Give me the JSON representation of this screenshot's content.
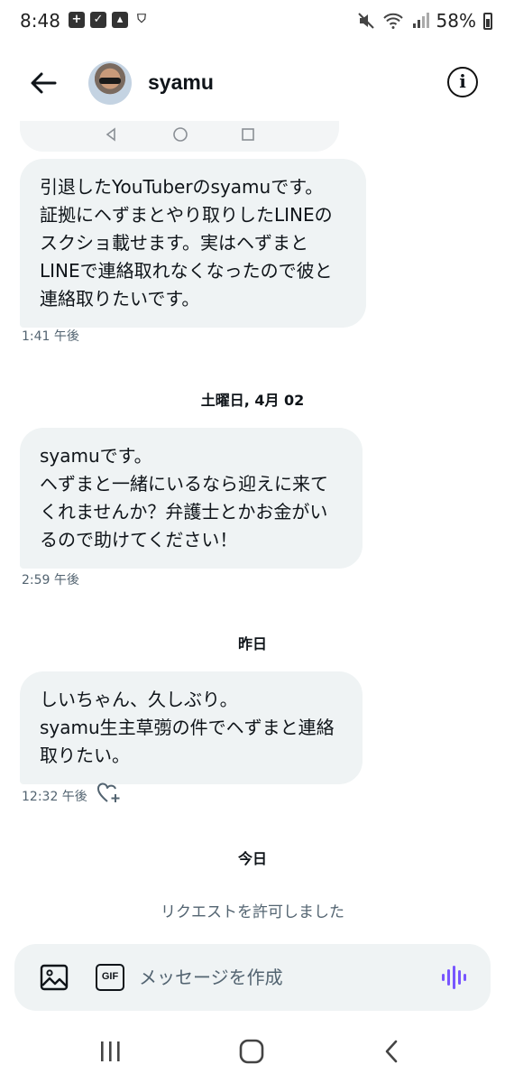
{
  "status_bar": {
    "time": "8:48",
    "battery": "58%"
  },
  "header": {
    "name": "syamu"
  },
  "messages": [
    {
      "text": "引退したYouTuberのsyamuです。\n証拠にヘずまとやり取りしたLINEの\nスクショ載せます。実はヘずまと\nLINEで連絡取れなくなったので彼と\n連絡取りたいです。",
      "time": "1:41 午後"
    },
    {
      "date": "土曜日, 4月 02"
    },
    {
      "text": "syamuです。\nヘずまと一緒にいるなら迎えに来て\nくれませんか？弁護士とかお金がい\nるので助けてください！",
      "time": "2:59 午後"
    },
    {
      "date": "昨日"
    },
    {
      "text": "しいちゃん、久しぶり。\nsyamu生主草彅の件でヘずまと連絡\n取りたい。",
      "time": "12:32 午後"
    },
    {
      "date": "今日"
    },
    {
      "system": "リクエストを許可しました"
    }
  ],
  "composer": {
    "placeholder": "メッセージを作成",
    "gif_label": "GIF"
  },
  "colors": {
    "bubble": "#eff3f4",
    "voice_accent": "#7856ff",
    "muted_text": "#536471"
  }
}
